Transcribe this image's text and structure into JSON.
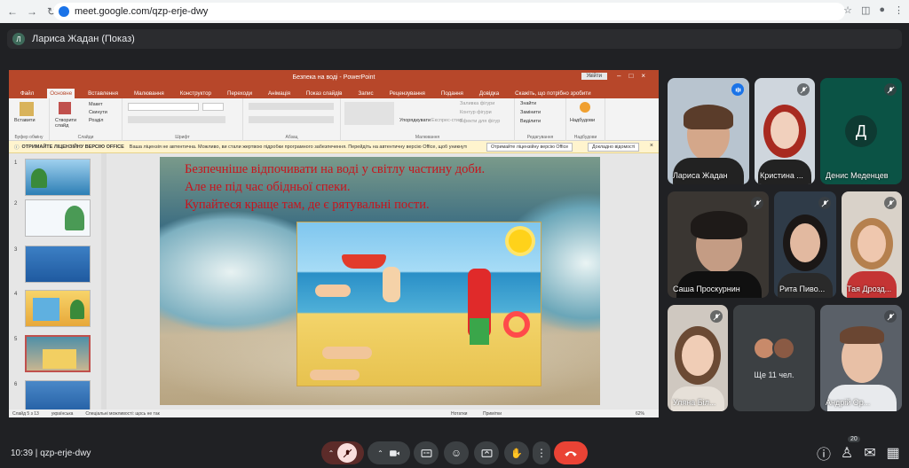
{
  "browser": {
    "url": "meet.google.com/qzp-erje-dwy",
    "colors": {
      "chrome": "#f1f3f4",
      "accent": "#1a73e8"
    }
  },
  "presenter": {
    "initial": "Л",
    "label": "Лариса Жадан (Показ)"
  },
  "powerpoint": {
    "window_title": "Безпека на воді - PowerPoint",
    "login_button": "Увійти",
    "tabs": [
      "Файл",
      "Основне",
      "Вставлення",
      "Малювання",
      "Конструктор",
      "Переходи",
      "Анімація",
      "Показ слайдів",
      "Запис",
      "Рецензування",
      "Подання",
      "Довідка"
    ],
    "active_tab": "Основне",
    "tell_me": "Скажіть, що потрібно зробити",
    "ribbon_groups": [
      "Буфер обміну",
      "Слайди",
      "Шрифт",
      "Абзац",
      "Малювання",
      "Редагування",
      "Надбудови"
    ],
    "ribbon_buttons": {
      "paste": "Вставити",
      "new_slide": "Створити слайд",
      "layout": "Макет",
      "reset": "Скинути",
      "section": "Розділ",
      "arrange": "Упорядкувати",
      "quick_styles": "Експрес-стилі",
      "shape_fill": "Заливка фігури",
      "shape_outline": "Контур фігури",
      "shape_effects": "Ефекти для фігур",
      "find": "Знайти",
      "replace": "Замінити",
      "select": "Виділити",
      "addins": "Надбудови"
    },
    "notice": {
      "title": "ОТРИМАЙТЕ ЛІЦЕНЗІЙНУ ВЕРСІЮ OFFICE",
      "text": "Ваша ліцензія не автентична. Можливо, ви стали жертвою підробки програмного забезпечення. Перейдіть на автентичну версію Office, щоб уникнути проблем у роботі та зберегти файли в безпеці.",
      "button_get": "Отримайте ліцензійну версію Office",
      "button_more": "Докладно відомості"
    },
    "slide_numbers": [
      "1",
      "2",
      "3",
      "4",
      "5",
      "6"
    ],
    "selected_slide": "5",
    "slide_text": [
      "Безпечніше відпочивати на воді у світлу частину доби.",
      "Але не під час обідньої спеки.",
      "Купайтеся краще там, де є рятувальні пости."
    ],
    "status": {
      "slide_of": "Слайд 5 з 13",
      "language": "українська",
      "accessibility": "Спеціальні можливості: щось не так",
      "notes": "Нотатки",
      "comments": "Примітки",
      "zoom": "62%"
    }
  },
  "participants": [
    {
      "name": "Лариса Жадан",
      "type": "video"
    },
    {
      "name": "Кристина ...",
      "type": "video"
    },
    {
      "name": "Денис Меденцев",
      "type": "avatar",
      "initial": "Д",
      "color": "#0b5345"
    },
    {
      "name": "Саша Проскурнин",
      "type": "video"
    },
    {
      "name": "Рита Пиво...",
      "type": "video"
    },
    {
      "name": "Тая Дрозд...",
      "type": "video"
    },
    {
      "name": "Уляна Біл...",
      "type": "video"
    },
    {
      "name": "Ще 11 чел.",
      "type": "more"
    },
    {
      "name": "Андрій Ор...",
      "type": "video"
    }
  ],
  "bottom": {
    "time": "10:39",
    "meeting_code": "qzp-erje-dwy",
    "participant_count": "20",
    "end_call_color": "#ea4335"
  }
}
